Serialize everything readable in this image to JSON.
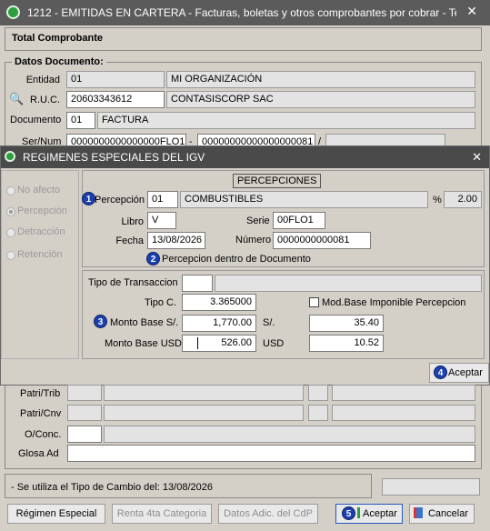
{
  "main_window": {
    "title": "1212 - EMITIDAS EN CARTERA - Facturas, boletas y otros comprobantes por cobrar - Te...",
    "close_glyph": "✕",
    "total_comprobante_label": "Total Comprobante",
    "datos_documento_title": "Datos Documento:",
    "entidad": {
      "label": "Entidad",
      "code": "01",
      "name": "MI ORGANIZACIÓN"
    },
    "ruc": {
      "label": "R.U.C.",
      "value": "20603343612",
      "name": "CONTASISCORP SAC"
    },
    "documento": {
      "label": "Documento",
      "code": "01",
      "name": "FACTURA"
    },
    "ser_num": {
      "label": "Ser/Num",
      "serie": "0000000000000000FLO1",
      "dash": "-",
      "numero": "00000000000000000081",
      "slash": "/"
    },
    "patri_trib_label": "Patri/Trib",
    "patri_cnv_label": "Patri/Cnv",
    "oconc_label": "O/Conc.",
    "glosa_label": "Glosa Ad",
    "tipo_cambio_note": "- Se utiliza el Tipo de Cambio del: 13/08/2026",
    "buttons": {
      "regimen_especial": "Régimen Especial",
      "renta_4ta": "Renta 4ta Categoria",
      "datos_adic": "Datos Adic. del CdP",
      "aceptar": "Aceptar",
      "cancelar": "Cancelar"
    }
  },
  "dialog": {
    "title": "REGIMENES ESPECIALES DEL IGV",
    "close_glyph": "✕",
    "options": [
      "No afecto",
      "Percepción",
      "Detracción",
      "Retención"
    ],
    "selected_option": "Percepción",
    "section_title": "PERCEPCIONES",
    "percepcion": {
      "label": "Percepción",
      "code": "01",
      "name": "COMBUSTIBLES",
      "pct_symbol": "%",
      "pct": "2.00"
    },
    "libro": {
      "label": "Libro",
      "value": "V"
    },
    "serie": {
      "label": "Serie",
      "value": "00FLO1"
    },
    "fecha": {
      "label": "Fecha",
      "value": "13/08/2026"
    },
    "numero": {
      "label": "Número",
      "value": "0000000000081"
    },
    "percepcion_note": "Percepcion dentro de Documento",
    "tipo_transaccion": {
      "label": "Tipo de Transaccion",
      "value": ""
    },
    "tipo_c": {
      "label": "Tipo C.",
      "value": "3.365000"
    },
    "mod_base_label": "Mod.Base Imponible Percepcion",
    "mod_base_checked": false,
    "monto_base_soles": {
      "label": "Monto Base S/.",
      "value": "1,770.00",
      "currency": "S/.",
      "percepcion": "35.40"
    },
    "monto_base_usd": {
      "label": "Monto Base USD",
      "value": "526.00",
      "currency": "USD",
      "percepcion": "10.52"
    },
    "aceptar": "Aceptar"
  },
  "badges": [
    "1",
    "2",
    "3",
    "4",
    "5"
  ],
  "colors": {
    "titlebar": "#5b5b5b",
    "dialog_titlebar": "#4a4a4a",
    "badge": "#1c3fb0",
    "background": "#d4d0c8"
  }
}
